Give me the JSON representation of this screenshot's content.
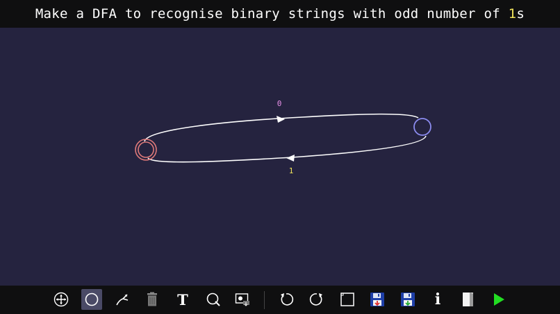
{
  "title": {
    "prefix": "Make a DFA to recognise binary strings with odd number of ",
    "highlight": "1",
    "suffix": "s",
    "highlight_color": "#f2e55c"
  },
  "colors": {
    "background": "#25233f",
    "bar": "#0f0f10",
    "final_state": "#e07a7a",
    "state": "#8c8cf0",
    "edge": "#ffffff",
    "label_0": "#e890e8",
    "label_1": "#f2e55c",
    "run": "#22dd22"
  },
  "automaton": {
    "states": [
      {
        "id": "q_left",
        "accepting": true
      },
      {
        "id": "q_right",
        "accepting": false
      }
    ],
    "transitions": [
      {
        "from": "q_left",
        "to": "q_right",
        "label": "0"
      },
      {
        "from": "q_right",
        "to": "q_left",
        "label": "1"
      }
    ]
  },
  "toolbar": {
    "tools": [
      {
        "name": "move-tool",
        "icon": "move-icon",
        "active": false
      },
      {
        "name": "add-state-tool",
        "icon": "circle-icon",
        "active": true
      },
      {
        "name": "add-transition-tool",
        "icon": "transition-icon",
        "active": false
      },
      {
        "name": "delete-tool",
        "icon": "trash-icon",
        "active": false
      },
      {
        "name": "text-tool",
        "icon": "text-icon",
        "active": false,
        "glyph": "T"
      },
      {
        "name": "zoom-tool",
        "icon": "magnifier-icon",
        "active": false
      },
      {
        "name": "screenshot-tool",
        "icon": "camera-icon",
        "active": false
      },
      {
        "name": "undo-button",
        "icon": "undo-icon",
        "active": false
      },
      {
        "name": "redo-button",
        "icon": "redo-icon",
        "active": false
      },
      {
        "name": "clear-canvas-button",
        "icon": "square-icon",
        "active": false
      },
      {
        "name": "save-button",
        "icon": "save-icon",
        "active": false
      },
      {
        "name": "save-as-button",
        "icon": "save-as-icon",
        "active": false
      },
      {
        "name": "info-button",
        "icon": "info-icon",
        "active": false,
        "glyph": "i"
      },
      {
        "name": "open-button",
        "icon": "book-icon",
        "active": false
      },
      {
        "name": "run-button",
        "icon": "play-icon",
        "active": false
      }
    ]
  }
}
